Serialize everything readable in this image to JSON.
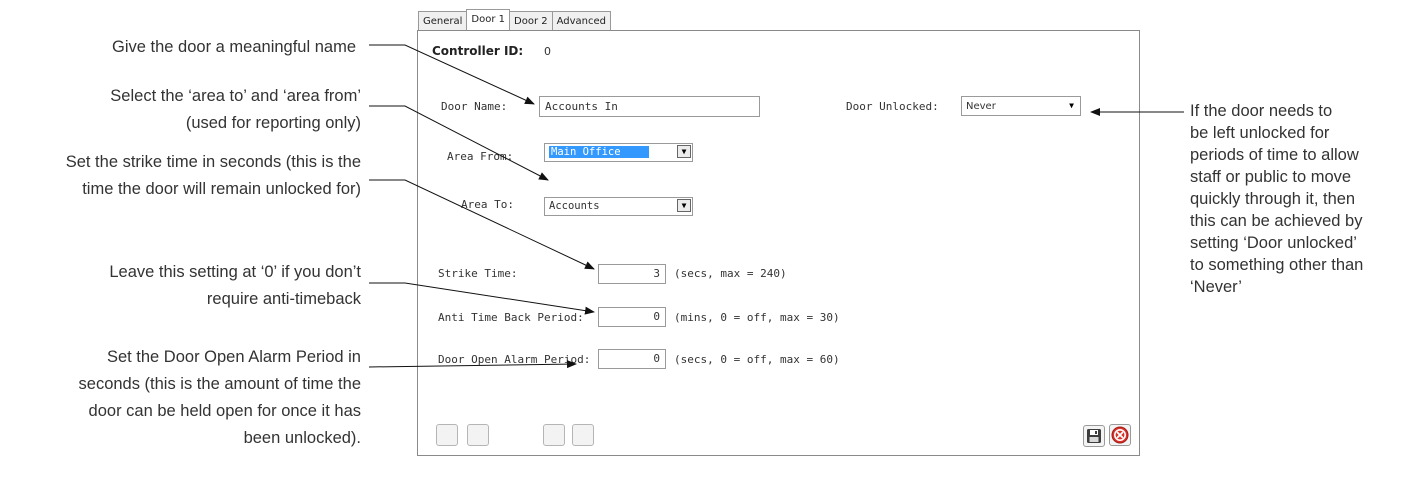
{
  "annotations": {
    "name_hint": "Give the door a meaningful name",
    "area_hint_1": "Select the ‘area to’ and ‘area from’",
    "area_hint_2": "(used for reporting only)",
    "strike_hint_1": "Set the strike time in seconds (this is the",
    "strike_hint_2": "time the door will remain unlocked for)",
    "atb_hint_1": "Leave this setting at ‘0’ if you don’t",
    "atb_hint_2": "require anti-timeback",
    "alarm_hint_1": "Set the Door Open Alarm Period in",
    "alarm_hint_2": "seconds (this is the amount of time the",
    "alarm_hint_3": "door can be held open for once it has",
    "alarm_hint_4": "been unlocked).",
    "unlock_hint_1": "If the door needs to",
    "unlock_hint_2": "be left unlocked for",
    "unlock_hint_3": "periods of time to allow",
    "unlock_hint_4": "staff or public to move",
    "unlock_hint_5": "quickly through it, then",
    "unlock_hint_6": "this can be achieved by",
    "unlock_hint_7": "setting ‘Door unlocked’",
    "unlock_hint_8": "to something other than",
    "unlock_hint_9": "‘Never’"
  },
  "tabs": [
    "General",
    "Door 1",
    "Door 2",
    "Advanced"
  ],
  "active_tab": "Door 1",
  "form": {
    "controller_id_label": "Controller ID:",
    "controller_id_value": "0",
    "door_name_label": "Door Name:",
    "door_name_value": "Accounts In",
    "door_unlocked_label": "Door Unlocked:",
    "door_unlocked_value": "Never",
    "area_from_label": "Area From:",
    "area_from_value": "Main Office",
    "area_to_label": "Area To:",
    "area_to_value": "Accounts",
    "strike_time_label": "Strike Time:",
    "strike_time_value": "3",
    "strike_time_hint": "(secs, max = 240)",
    "anti_time_back_label": "Anti Time Back Period:",
    "anti_time_back_value": "0",
    "anti_time_back_hint": "(mins, 0 = off, max = 30)",
    "door_open_alarm_label": "Door Open Alarm Period:",
    "door_open_alarm_value": "0",
    "door_open_alarm_hint": "(secs, 0 = off, max = 60)"
  },
  "icons": {
    "save": "save-icon",
    "close": "close-icon"
  },
  "colors": {
    "selection": "#3399ff",
    "close_red": "#d9332b"
  }
}
